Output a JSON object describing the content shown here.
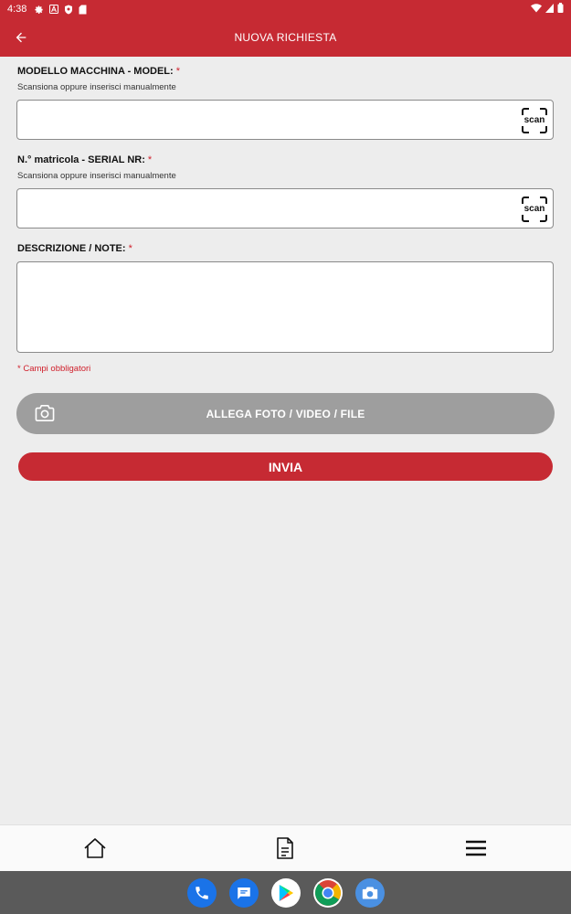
{
  "status_bar": {
    "time": "4:38"
  },
  "app_bar": {
    "title": "NUOVA RICHIESTA"
  },
  "form": {
    "model": {
      "label": "MODELLO MACCHINA - MODEL:",
      "required_mark": "*",
      "hint": "Scansiona oppure inserisci manualmente",
      "value": "",
      "scan_label": "scan"
    },
    "serial": {
      "label": "N.° matricola - SERIAL NR:",
      "required_mark": "*",
      "hint": "Scansiona oppure inserisci manualmente",
      "value": "",
      "scan_label": "scan"
    },
    "description": {
      "label": "DESCRIZIONE / NOTE:",
      "required_mark": "*",
      "value": ""
    },
    "required_note": "* Campi obbligatori",
    "attach_label": "ALLEGA FOTO / VIDEO / FILE",
    "send_label": "INVIA"
  },
  "bottom_nav": {
    "items": [
      {
        "icon": "home-icon"
      },
      {
        "icon": "document-icon"
      },
      {
        "icon": "menu-icon"
      }
    ]
  },
  "dock": {
    "apps": [
      "phone-icon",
      "messages-icon",
      "play-store-icon",
      "chrome-icon",
      "camera-icon"
    ]
  },
  "colors": {
    "primary": "#c62a33",
    "attach_button": "#9e9e9e",
    "required": "#d0202c",
    "background": "#ededed"
  }
}
